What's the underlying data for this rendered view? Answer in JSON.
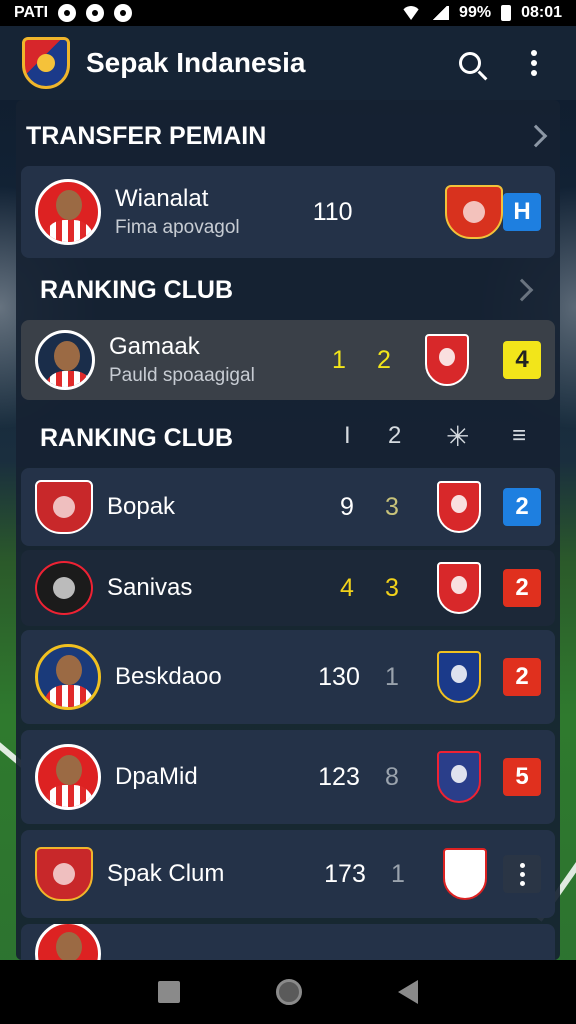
{
  "status_bar": {
    "carrier": "PATI",
    "battery": "99%",
    "time": "08:01"
  },
  "app_bar": {
    "title": "Sepak Indanesia"
  },
  "transfer_section": {
    "title": "TRANSFER PEMAIN",
    "card": {
      "name": "Wianalat",
      "sub": "Fima apovagol",
      "stat": "110",
      "badge": "H"
    }
  },
  "ranking_section_1": {
    "title": "RANKING CLUB",
    "card": {
      "name": "Gamaak",
      "sub": "Pauld spoaagigal",
      "stat1": "1",
      "stat2": "2",
      "badge": "4"
    }
  },
  "ranking_section_2": {
    "title": "RANKING CLUB",
    "col1": "I",
    "col2": "2",
    "rows": [
      {
        "name": "Bopak",
        "stat1": "9",
        "stat2": "3",
        "badge": "2"
      },
      {
        "name": "Sanivas",
        "stat1": "4",
        "stat2": "3",
        "badge": "2"
      },
      {
        "name": "Beskdaoo",
        "stat1": "130",
        "stat2": "1",
        "badge": "2"
      },
      {
        "name": "DpaMid",
        "stat1": "123",
        "stat2": "8",
        "badge": "5"
      },
      {
        "name": "Spak Clum",
        "stat1": "173",
        "stat2": "1",
        "badge": ""
      }
    ]
  },
  "colors": {
    "accent_blue": "#1e7fe0",
    "accent_yellow": "#f2e51a",
    "accent_red": "#e0301e",
    "panel": "#162232"
  }
}
